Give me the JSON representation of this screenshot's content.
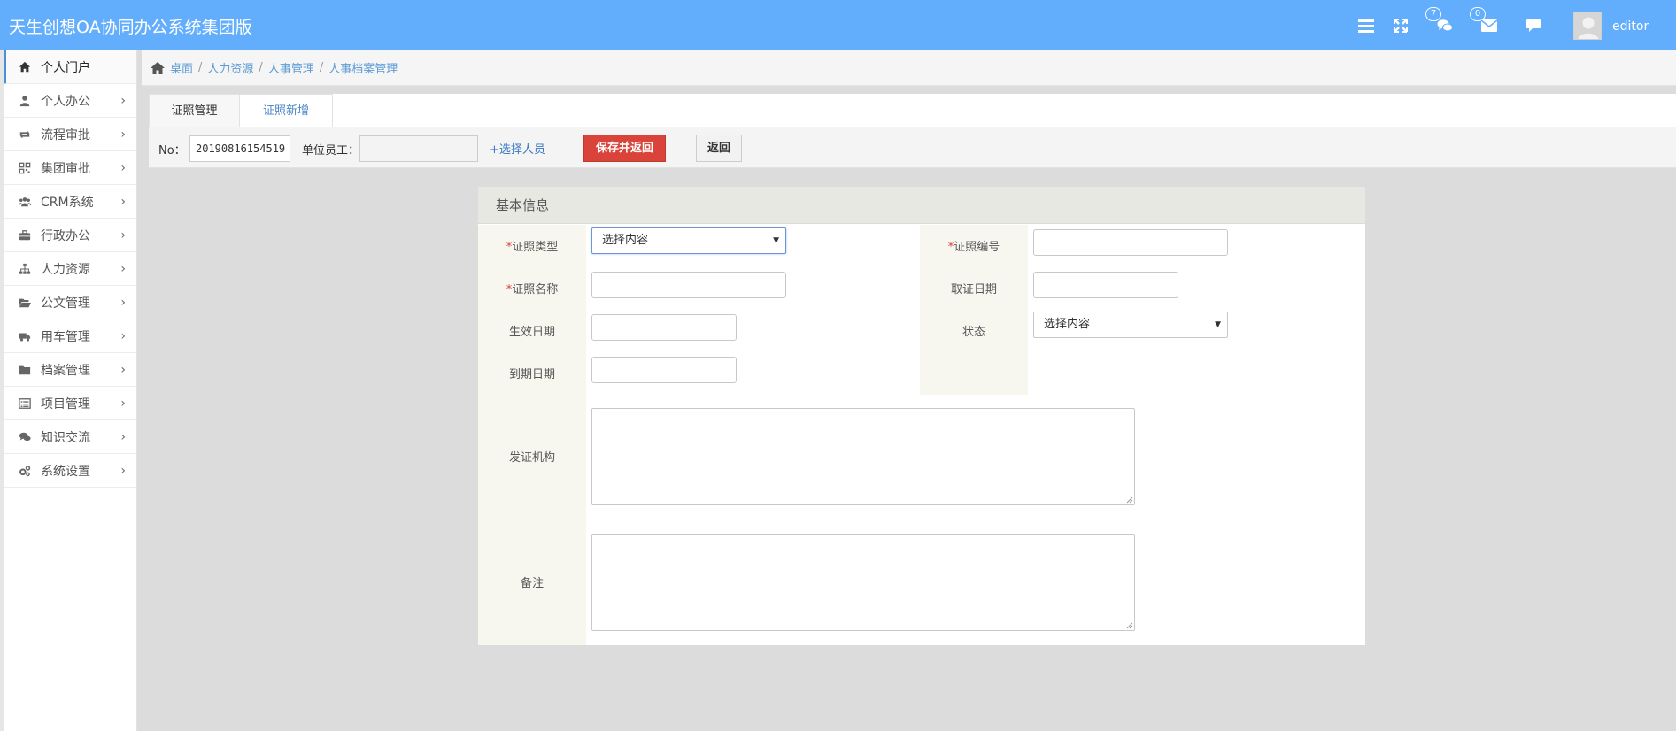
{
  "header": {
    "app_title": "天生创想OA协同办公系统集团版",
    "chat_badge": "7",
    "mail_badge": "0",
    "username": "editor"
  },
  "sidebar": {
    "items": [
      {
        "label": "个人门户",
        "icon": "home-icon",
        "active": true
      },
      {
        "label": "个人办公",
        "icon": "user-icon"
      },
      {
        "label": "流程审批",
        "icon": "retweet-icon"
      },
      {
        "label": "集团审批",
        "icon": "qrcode-icon"
      },
      {
        "label": "CRM系统",
        "icon": "group-icon"
      },
      {
        "label": "行政办公",
        "icon": "briefcase-icon"
      },
      {
        "label": "人力资源",
        "icon": "sitemap-icon"
      },
      {
        "label": "公文管理",
        "icon": "folder-open-icon"
      },
      {
        "label": "用车管理",
        "icon": "truck-icon"
      },
      {
        "label": "档案管理",
        "icon": "folder-icon"
      },
      {
        "label": "项目管理",
        "icon": "list-alt-icon"
      },
      {
        "label": "知识交流",
        "icon": "comments-icon"
      },
      {
        "label": "系统设置",
        "icon": "cogs-icon"
      }
    ]
  },
  "breadcrumb": [
    "桌面",
    "人力资源",
    "人事管理",
    "人事档案管理"
  ],
  "tabs": [
    "证照管理",
    "证照新增"
  ],
  "toolbar": {
    "no_label": "No：",
    "no_value": "20190816154519",
    "employee_label": "单位员工：",
    "employee_value": "",
    "select_person": "+选择人员",
    "save_label": "保存并返回",
    "back_label": "返回"
  },
  "form": {
    "section_title": "基本信息",
    "cert_type_label": "证照类型",
    "cert_type_value": "选择内容",
    "cert_no_label": "证照编号",
    "cert_name_label": "证照名称",
    "obtain_date_label": "取证日期",
    "effective_date_label": "生效日期",
    "status_label": "状态",
    "status_value": "选择内容",
    "expiry_date_label": "到期日期",
    "issuer_label": "发证机构",
    "remark_label": "备注"
  },
  "colors": {
    "header_bg": "#62aefd",
    "save_button": "#d9433a",
    "link": "#5b9bd5"
  }
}
